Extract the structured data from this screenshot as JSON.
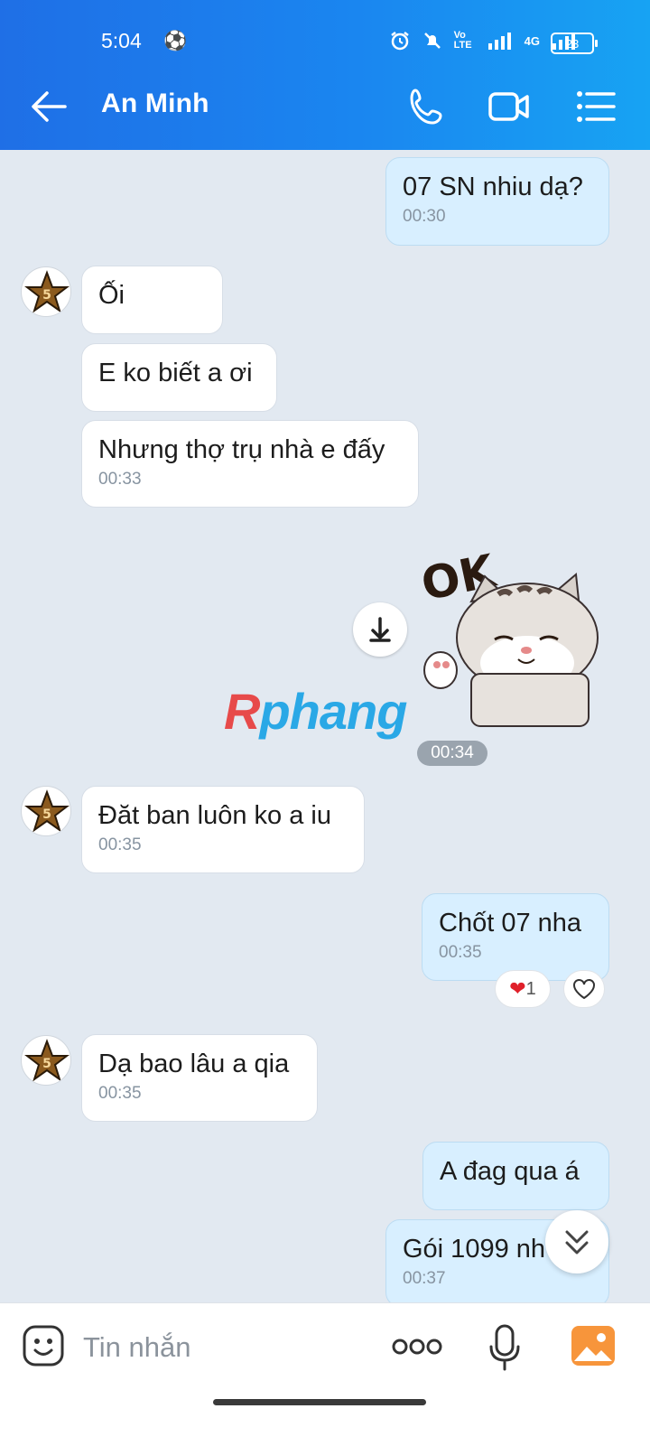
{
  "status": {
    "time": "5:04",
    "network": "4G",
    "volte": "Vo LTE",
    "battery": "23"
  },
  "header": {
    "contact_name": "An Minh"
  },
  "messages": [
    {
      "dir": "out",
      "text": "07 SN nhiu dạ?",
      "time": "00:30"
    },
    {
      "dir": "in",
      "text": "Ối"
    },
    {
      "dir": "in",
      "text": "E ko biết a ơi"
    },
    {
      "dir": "in",
      "text": "Nhưng thợ trụ nhà e đấy",
      "time": "00:33"
    },
    {
      "dir": "in",
      "type": "sticker",
      "sticker_text": "OK",
      "time": "00:34"
    },
    {
      "dir": "in",
      "text": "Đăt ban luôn ko a iu",
      "time": "00:35"
    },
    {
      "dir": "out",
      "text": "Chốt 07 nha",
      "time": "00:35",
      "reaction": "❤",
      "reaction_count": "1"
    },
    {
      "dir": "in",
      "text": "Dạ bao lâu a qia",
      "time": "00:35"
    },
    {
      "dir": "out",
      "text": "A đag qua á"
    },
    {
      "dir": "out",
      "text": "Gói 1099 nh",
      "time": "00:37"
    }
  ],
  "watermark": {
    "lead": "R",
    "rest": "phang"
  },
  "input": {
    "placeholder": "Tin nhắn"
  },
  "colors": {
    "header_start": "#1f6fe6",
    "header_end": "#17a3f3",
    "bg": "#e2e9f1",
    "outgoing": "#d8efff",
    "gallery": "#f7953b"
  }
}
